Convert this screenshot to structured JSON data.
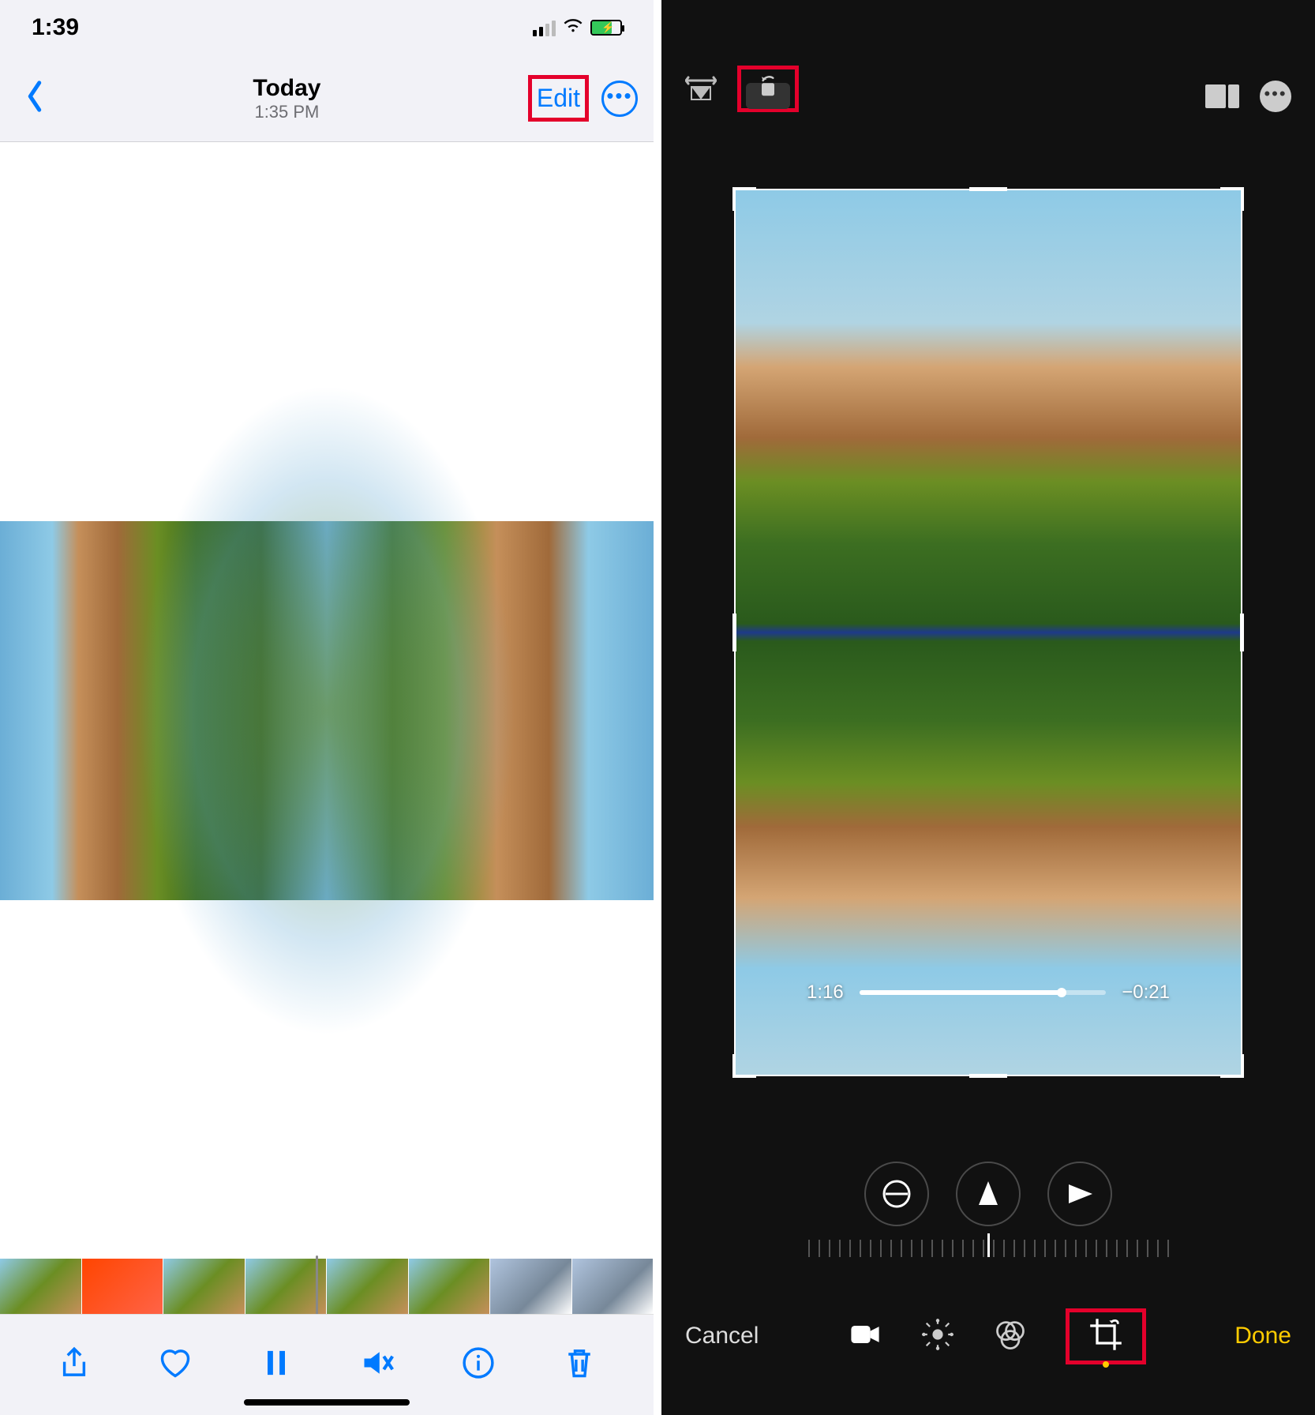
{
  "left": {
    "status": {
      "time": "1:39"
    },
    "nav": {
      "title": "Today",
      "subtitle": "1:35 PM",
      "edit": "Edit"
    }
  },
  "right": {
    "playback": {
      "elapsed": "1:16",
      "remaining": "−0:21"
    },
    "buttons": {
      "cancel": "Cancel",
      "done": "Done"
    }
  }
}
